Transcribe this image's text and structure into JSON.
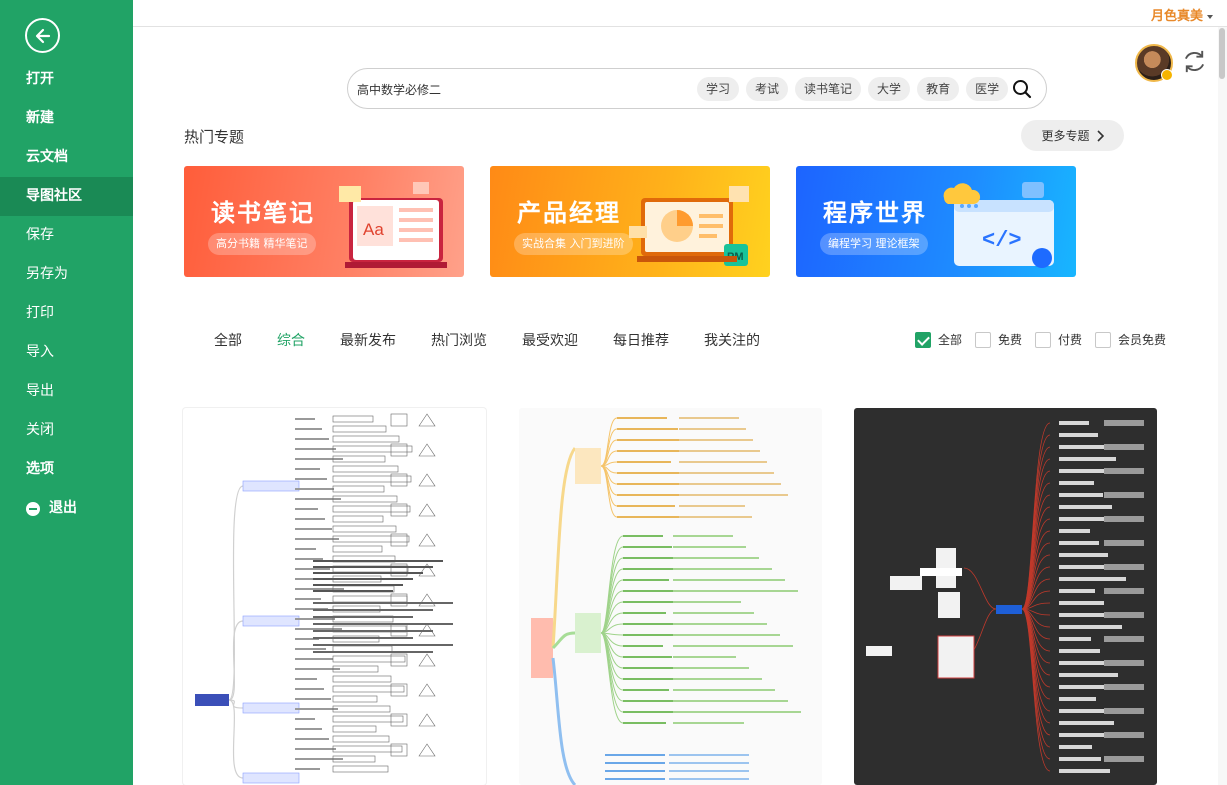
{
  "sidebar": {
    "items": [
      {
        "label": "打开"
      },
      {
        "label": "新建"
      },
      {
        "label": "云文档"
      },
      {
        "label": "导图社区"
      },
      {
        "label": "保存"
      },
      {
        "label": "另存为"
      },
      {
        "label": "打印"
      },
      {
        "label": "导入"
      },
      {
        "label": "导出"
      },
      {
        "label": "关闭"
      },
      {
        "label": "选项"
      },
      {
        "label": "退出"
      }
    ],
    "active": "导图社区"
  },
  "header": {
    "user_name": "月色真美"
  },
  "search": {
    "value": "高中数学必修二",
    "tags": [
      "学习",
      "考试",
      "读书笔记",
      "大学",
      "教育",
      "医学"
    ]
  },
  "hot": {
    "title": "热门专题",
    "more_label": "更多专题",
    "banners": [
      {
        "title": "读书笔记",
        "subtitle": "高分书籍 精华笔记",
        "art_label": "Aa"
      },
      {
        "title": "产品经理",
        "subtitle": "实战合集 入门到进阶",
        "art_label": "PM"
      },
      {
        "title": "程序世界",
        "subtitle": "编程学习 理论框架",
        "art_label": "</>"
      }
    ]
  },
  "tabs": [
    "全部",
    "综合",
    "最新发布",
    "热门浏览",
    "最受欢迎",
    "每日推荐",
    "我关注的"
  ],
  "active_tab": "综合",
  "filters": [
    {
      "label": "全部",
      "checked": true
    },
    {
      "label": "免费",
      "checked": false
    },
    {
      "label": "付费",
      "checked": false
    },
    {
      "label": "会员免费",
      "checked": false
    }
  ],
  "colors": {
    "brand": "#21a366",
    "user": "#e8892a"
  },
  "icons": [
    "back-arrow-icon",
    "refresh-icon",
    "search-icon",
    "chevron-right-icon",
    "minus-circle-icon"
  ]
}
